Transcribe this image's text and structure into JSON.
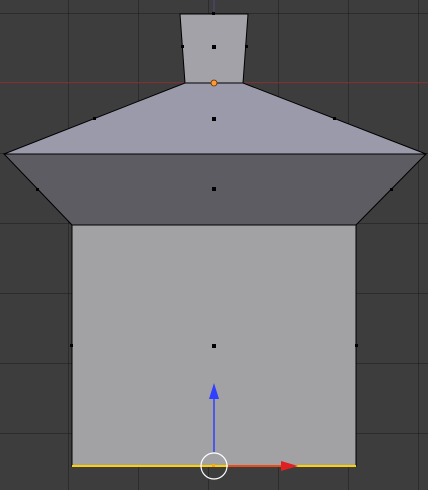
{
  "app": {
    "type": "3d-viewport",
    "view": "front-orthographic",
    "mode": "edit-mode"
  },
  "colors": {
    "background": "#3d3d3d",
    "grid_line": "#313131",
    "x_axis_line": "#8a3a3a",
    "face_neck": "#a2a2a8",
    "face_shoulder": "#9a9aaa",
    "face_band": "#5c5c62",
    "face_body": "#a2a2a4",
    "edge": "#000000",
    "selected_edge": "#ffd000",
    "selected_vertex": "#ff9933",
    "manipulator_x": "#e02020",
    "manipulator_z": "#3040ff",
    "manipulator_ring": "#ffffff"
  },
  "mesh": {
    "name": "mesh-object",
    "face_count": 4,
    "selected_edge": "bottom-edge"
  },
  "manipulator": {
    "type": "translate",
    "axes": [
      "x-axis",
      "z-axis"
    ]
  }
}
